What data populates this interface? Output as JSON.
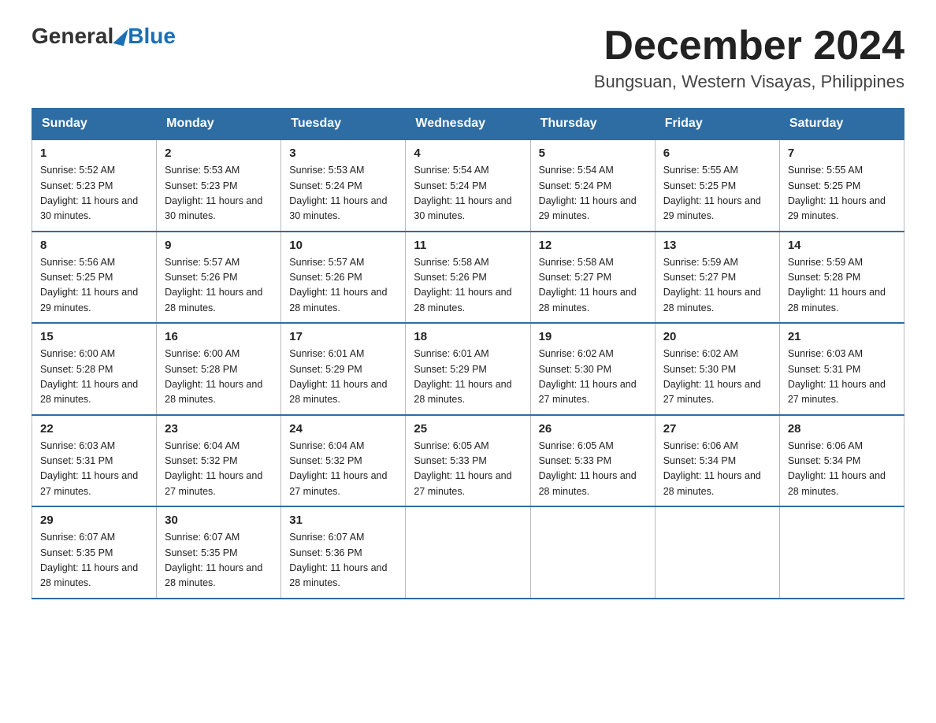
{
  "header": {
    "logo_text_general": "General",
    "logo_text_blue": "Blue",
    "month_title": "December 2024",
    "location": "Bungsuan, Western Visayas, Philippines"
  },
  "weekdays": [
    "Sunday",
    "Monday",
    "Tuesday",
    "Wednesday",
    "Thursday",
    "Friday",
    "Saturday"
  ],
  "weeks": [
    [
      {
        "day": "1",
        "sunrise": "5:52 AM",
        "sunset": "5:23 PM",
        "daylight": "11 hours and 30 minutes."
      },
      {
        "day": "2",
        "sunrise": "5:53 AM",
        "sunset": "5:23 PM",
        "daylight": "11 hours and 30 minutes."
      },
      {
        "day": "3",
        "sunrise": "5:53 AM",
        "sunset": "5:24 PM",
        "daylight": "11 hours and 30 minutes."
      },
      {
        "day": "4",
        "sunrise": "5:54 AM",
        "sunset": "5:24 PM",
        "daylight": "11 hours and 30 minutes."
      },
      {
        "day": "5",
        "sunrise": "5:54 AM",
        "sunset": "5:24 PM",
        "daylight": "11 hours and 29 minutes."
      },
      {
        "day": "6",
        "sunrise": "5:55 AM",
        "sunset": "5:25 PM",
        "daylight": "11 hours and 29 minutes."
      },
      {
        "day": "7",
        "sunrise": "5:55 AM",
        "sunset": "5:25 PM",
        "daylight": "11 hours and 29 minutes."
      }
    ],
    [
      {
        "day": "8",
        "sunrise": "5:56 AM",
        "sunset": "5:25 PM",
        "daylight": "11 hours and 29 minutes."
      },
      {
        "day": "9",
        "sunrise": "5:57 AM",
        "sunset": "5:26 PM",
        "daylight": "11 hours and 28 minutes."
      },
      {
        "day": "10",
        "sunrise": "5:57 AM",
        "sunset": "5:26 PM",
        "daylight": "11 hours and 28 minutes."
      },
      {
        "day": "11",
        "sunrise": "5:58 AM",
        "sunset": "5:26 PM",
        "daylight": "11 hours and 28 minutes."
      },
      {
        "day": "12",
        "sunrise": "5:58 AM",
        "sunset": "5:27 PM",
        "daylight": "11 hours and 28 minutes."
      },
      {
        "day": "13",
        "sunrise": "5:59 AM",
        "sunset": "5:27 PM",
        "daylight": "11 hours and 28 minutes."
      },
      {
        "day": "14",
        "sunrise": "5:59 AM",
        "sunset": "5:28 PM",
        "daylight": "11 hours and 28 minutes."
      }
    ],
    [
      {
        "day": "15",
        "sunrise": "6:00 AM",
        "sunset": "5:28 PM",
        "daylight": "11 hours and 28 minutes."
      },
      {
        "day": "16",
        "sunrise": "6:00 AM",
        "sunset": "5:28 PM",
        "daylight": "11 hours and 28 minutes."
      },
      {
        "day": "17",
        "sunrise": "6:01 AM",
        "sunset": "5:29 PM",
        "daylight": "11 hours and 28 minutes."
      },
      {
        "day": "18",
        "sunrise": "6:01 AM",
        "sunset": "5:29 PM",
        "daylight": "11 hours and 28 minutes."
      },
      {
        "day": "19",
        "sunrise": "6:02 AM",
        "sunset": "5:30 PM",
        "daylight": "11 hours and 27 minutes."
      },
      {
        "day": "20",
        "sunrise": "6:02 AM",
        "sunset": "5:30 PM",
        "daylight": "11 hours and 27 minutes."
      },
      {
        "day": "21",
        "sunrise": "6:03 AM",
        "sunset": "5:31 PM",
        "daylight": "11 hours and 27 minutes."
      }
    ],
    [
      {
        "day": "22",
        "sunrise": "6:03 AM",
        "sunset": "5:31 PM",
        "daylight": "11 hours and 27 minutes."
      },
      {
        "day": "23",
        "sunrise": "6:04 AM",
        "sunset": "5:32 PM",
        "daylight": "11 hours and 27 minutes."
      },
      {
        "day": "24",
        "sunrise": "6:04 AM",
        "sunset": "5:32 PM",
        "daylight": "11 hours and 27 minutes."
      },
      {
        "day": "25",
        "sunrise": "6:05 AM",
        "sunset": "5:33 PM",
        "daylight": "11 hours and 27 minutes."
      },
      {
        "day": "26",
        "sunrise": "6:05 AM",
        "sunset": "5:33 PM",
        "daylight": "11 hours and 28 minutes."
      },
      {
        "day": "27",
        "sunrise": "6:06 AM",
        "sunset": "5:34 PM",
        "daylight": "11 hours and 28 minutes."
      },
      {
        "day": "28",
        "sunrise": "6:06 AM",
        "sunset": "5:34 PM",
        "daylight": "11 hours and 28 minutes."
      }
    ],
    [
      {
        "day": "29",
        "sunrise": "6:07 AM",
        "sunset": "5:35 PM",
        "daylight": "11 hours and 28 minutes."
      },
      {
        "day": "30",
        "sunrise": "6:07 AM",
        "sunset": "5:35 PM",
        "daylight": "11 hours and 28 minutes."
      },
      {
        "day": "31",
        "sunrise": "6:07 AM",
        "sunset": "5:36 PM",
        "daylight": "11 hours and 28 minutes."
      },
      null,
      null,
      null,
      null
    ]
  ]
}
